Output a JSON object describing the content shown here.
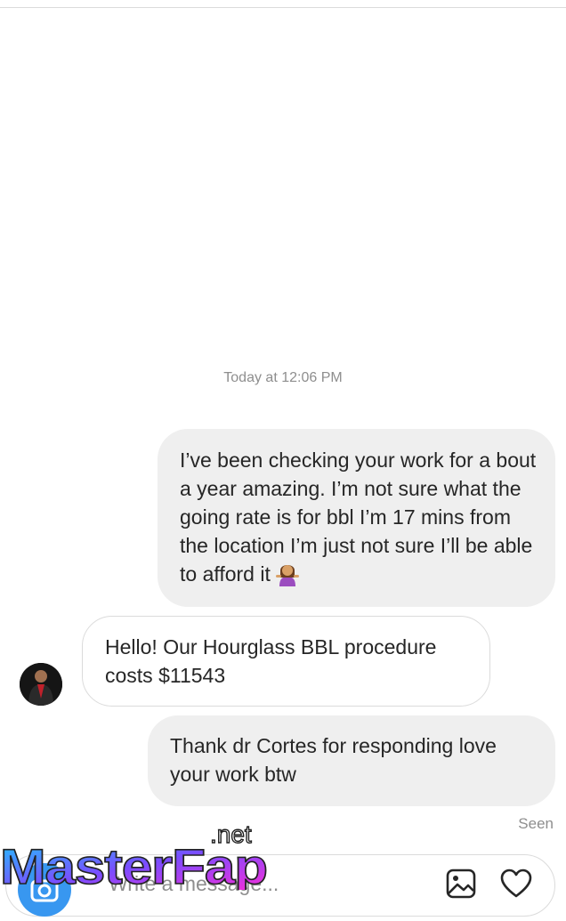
{
  "thread": {
    "timestamp": "Today at 12:06 PM",
    "messages": [
      {
        "sender": "me",
        "text": "I’ve been checking your work for a bout a year amazing. I’m not sure what the going rate is for bbl I’m 17 mins from the location I’m just not sure I’ll be able to afford it",
        "emoji": "woman-shrugging-emoji"
      },
      {
        "sender": "them",
        "text": "Hello! Our Hourglass BBL procedure costs $11543"
      },
      {
        "sender": "me",
        "text": "Thank dr Cortes for responding love your work btw"
      }
    ],
    "seen_label": "Seen"
  },
  "composer": {
    "placeholder": "Write a message...",
    "icons": [
      "camera-icon",
      "image-icon",
      "heart-icon"
    ],
    "accent_color": "#3897f0"
  },
  "watermark": {
    "text": "MasterFap",
    "suffix": ".net"
  },
  "colors": {
    "outgoing_bubble": "#efefef",
    "incoming_border": "#dbdbdb",
    "meta_text": "#8e8e8e"
  }
}
